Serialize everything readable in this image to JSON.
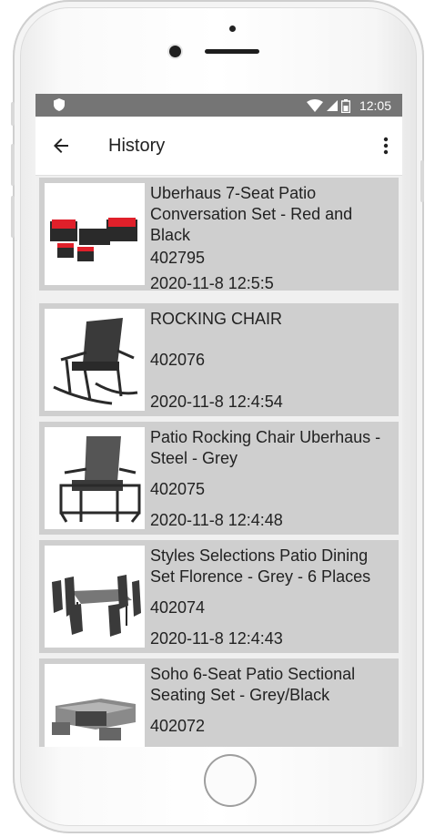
{
  "status_bar": {
    "time": "12:05"
  },
  "app_bar": {
    "title": "History"
  },
  "items": [
    {
      "name": "Uberhaus 7-Seat Patio Conversation Set - Red and Black",
      "code": "402795",
      "date": "2020-11-8 12:5:5"
    },
    {
      "name": "ROCKING CHAIR",
      "code": "402076",
      "date": "2020-11-8 12:4:54"
    },
    {
      "name": "Patio Rocking Chair Uberhaus - Steel - Grey",
      "code": "402075",
      "date": "2020-11-8 12:4:48"
    },
    {
      "name": "Styles Selections Patio Dining Set Florence - Grey - 6 Places",
      "code": "402074",
      "date": "2020-11-8 12:4:43"
    },
    {
      "name": "Soho 6-Seat Patio Sectional Seating Set - Grey/Black",
      "code": "402072"
    }
  ],
  "colors": {
    "status_bar": "#757575",
    "item_bg": "#cfcfcf",
    "accent_red": "#e0202a"
  }
}
